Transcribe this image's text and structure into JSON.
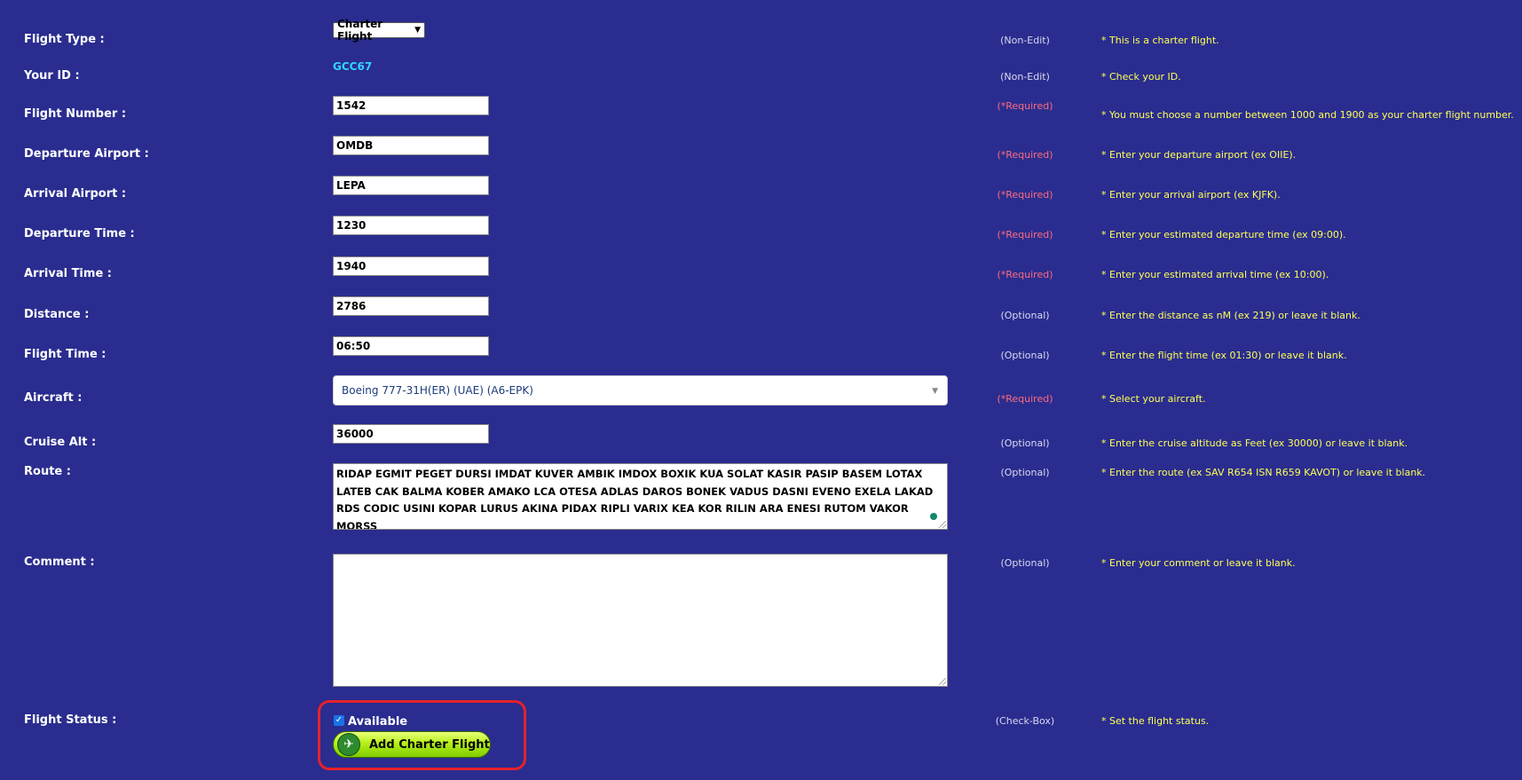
{
  "fields": {
    "flight_type": {
      "label": "Flight Type :",
      "value": "Charter Flight",
      "status": "(Non-Edit)",
      "hint": "* This is a charter flight."
    },
    "your_id": {
      "label": "Your ID :",
      "value": "GCC67",
      "status": "(Non-Edit)",
      "hint": "* Check your ID."
    },
    "flight_number": {
      "label": "Flight Number :",
      "value": "1542",
      "status": "(*Required)",
      "hint": "* You must choose a number between 1000 and 1900 as your charter flight number."
    },
    "departure_airport": {
      "label": "Departure Airport :",
      "value": "OMDB",
      "status": "(*Required)",
      "hint": "* Enter your departure airport (ex OIIE)."
    },
    "arrival_airport": {
      "label": "Arrival Airport :",
      "value": "LEPA",
      "status": "(*Required)",
      "hint": "* Enter your arrival airport (ex KJFK)."
    },
    "departure_time": {
      "label": "Departure Time :",
      "value": "1230",
      "status": "(*Required)",
      "hint": "* Enter your estimated departure time (ex 09:00)."
    },
    "arrival_time": {
      "label": "Arrival Time :",
      "value": "1940",
      "status": "(*Required)",
      "hint": "* Enter your estimated arrival time (ex 10:00)."
    },
    "distance": {
      "label": "Distance :",
      "value": "2786",
      "status": "(Optional)",
      "hint": "* Enter the distance as nM (ex 219) or leave it blank."
    },
    "flight_time": {
      "label": "Flight Time :",
      "value": "06:50",
      "status": "(Optional)",
      "hint": "* Enter the flight time (ex 01:30) or leave it blank."
    },
    "aircraft": {
      "label": "Aircraft :",
      "value": "Boeing 777-31H(ER) (UAE) (A6-EPK)",
      "status": "(*Required)",
      "hint": "* Select your aircraft."
    },
    "cruise_alt": {
      "label": "Cruise Alt :",
      "value": "36000",
      "status": "(Optional)",
      "hint": "* Enter the cruise altitude as Feet (ex 30000) or leave it blank."
    },
    "route": {
      "label": "Route :",
      "value": "RIDAP EGMIT PEGET DURSI IMDAT KUVER AMBIK IMDOX BOXIK KUA SOLAT KASIR PASIP BASEM LOTAX LATEB CAK BALMA KOBER AMAKO LCA OTESA ADLAS DAROS BONEK VADUS DASNI EVENO EXELA LAKAD RDS CODIC USINI KOPAR LURUS AKINA PIDAX RIPLI VARIX KEA KOR RILIN ARA ENESI RUTOM VAKOR MORSS",
      "status": "(Optional)",
      "hint": "* Enter the route (ex SAV R654 ISN R659 KAVOT) or leave it blank."
    },
    "comment": {
      "label": "Comment :",
      "value": "",
      "status": "(Optional)",
      "hint": "* Enter your comment or leave it blank."
    },
    "flight_status": {
      "label": "Flight Status :",
      "checkbox_label": "Available",
      "checked": true,
      "status": "(Check-Box)",
      "hint": "* Set the flight status."
    }
  },
  "submit": {
    "label": "Add Charter Flight",
    "icon": "airplane-icon"
  },
  "colors": {
    "background": "#2a2d8f",
    "label": "#ffffff",
    "hint": "#ffff55",
    "required": "#ff6b7d",
    "id_value": "#33d6ff",
    "highlight": "#e8212b"
  }
}
